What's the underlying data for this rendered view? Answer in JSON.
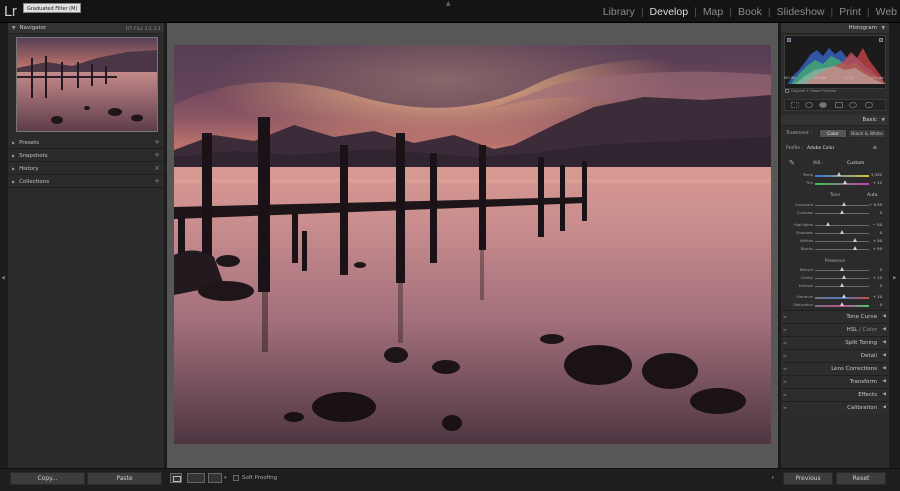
{
  "app": {
    "logo": "Lr",
    "tooltip": "Graduated Filter (M)"
  },
  "modules": [
    {
      "label": "Library",
      "active": false
    },
    {
      "label": "Develop",
      "active": true
    },
    {
      "label": "Map",
      "active": false
    },
    {
      "label": "Book",
      "active": false
    },
    {
      "label": "Slideshow",
      "active": false
    },
    {
      "label": "Print",
      "active": false
    },
    {
      "label": "Web",
      "active": false
    }
  ],
  "left_panel": {
    "navigator": {
      "title": "Navigator",
      "zoom_options": "FIT  FILL  1:1  3:1"
    },
    "items": [
      {
        "label": "Presets",
        "plus": "+"
      },
      {
        "label": "Snapshots",
        "plus": "+"
      },
      {
        "label": "History",
        "plus": "×"
      },
      {
        "label": "Collections",
        "plus": "+"
      }
    ],
    "copy_label": "Copy...",
    "paste_label": "Paste"
  },
  "toolbar": {
    "soft_proofing": "Soft Proofing"
  },
  "right_panel": {
    "histogram": {
      "title": "Histogram",
      "iso": "ISO 64",
      "focal": "12 mm",
      "aperture": "f / 11",
      "exposure": "0.0 sec",
      "preview": "Original + Smart Preview"
    },
    "basic": {
      "title": "Basic",
      "treatment_label": "Treatment :",
      "treatment_color": "Color",
      "treatment_bw": "Black & White",
      "profile_label": "Profile :",
      "profile_value": "Adobe Color",
      "wb_label": "WB :",
      "wb_value": "Custom",
      "tone_label": "Tone",
      "auto_label": "Auto",
      "presence_label": "Presence",
      "sliders": [
        {
          "id": "temp",
          "label": "Temp",
          "value": "5,332",
          "pos": 0.45
        },
        {
          "id": "tint",
          "label": "Tint",
          "value": "+ 12",
          "pos": 0.56
        },
        {
          "id": "exposure",
          "label": "Exposure",
          "value": "+ 0.35",
          "pos": 0.55
        },
        {
          "id": "contrast",
          "label": "Contrast",
          "value": "0",
          "pos": 0.5
        },
        {
          "id": "highlights",
          "label": "Highlights",
          "value": "− 50",
          "pos": 0.25
        },
        {
          "id": "shadows",
          "label": "Shadows",
          "value": "0",
          "pos": 0.5
        },
        {
          "id": "whites",
          "label": "Whites",
          "value": "+ 50",
          "pos": 0.75
        },
        {
          "id": "blacks",
          "label": "Blacks",
          "value": "+ 50",
          "pos": 0.75
        },
        {
          "id": "texture",
          "label": "Texture",
          "value": "0",
          "pos": 0.5
        },
        {
          "id": "clarity",
          "label": "Clarity",
          "value": "+ 10",
          "pos": 0.55
        },
        {
          "id": "dehaze",
          "label": "Dehaze",
          "value": "0",
          "pos": 0.5
        },
        {
          "id": "vibrance",
          "label": "Vibrance",
          "value": "+ 10",
          "pos": 0.55
        },
        {
          "id": "saturation",
          "label": "Saturation",
          "value": "0",
          "pos": 0.5
        }
      ]
    },
    "sections": [
      {
        "label": "Tone Curve"
      },
      {
        "label": "HSL",
        "suffix": " / Color"
      },
      {
        "label": "Split Toning"
      },
      {
        "label": "Detail"
      },
      {
        "label": "Lens Corrections"
      },
      {
        "label": "Transform"
      },
      {
        "label": "Effects"
      },
      {
        "label": "Calibration"
      }
    ],
    "previous_label": "Previous",
    "reset_label": "Reset"
  },
  "colors": {
    "panel_bg": "#2b2b2b",
    "center_bg": "#575757",
    "active_module": "#dcdcdc"
  }
}
